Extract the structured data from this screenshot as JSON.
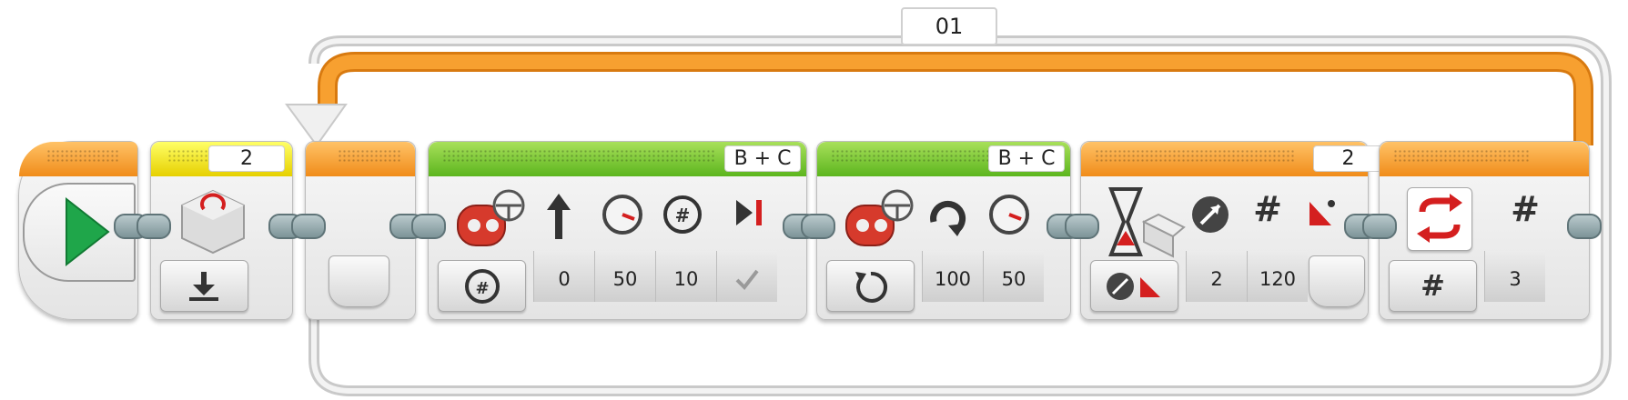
{
  "loop": {
    "name_label": "01"
  },
  "blocks": {
    "start": {},
    "brick": {
      "header_value": "2"
    },
    "move_tank_1": {
      "ports": "B + C",
      "params": [
        "0",
        "50",
        "10"
      ]
    },
    "move_tank_2": {
      "ports": "B + C",
      "params": [
        "100",
        "50"
      ]
    },
    "wait": {
      "header_value": "2",
      "params": [
        "2",
        "120"
      ]
    },
    "loop_interrupt": {
      "params": [
        "3"
      ]
    }
  },
  "colors": {
    "flow_orange": "#f7941d",
    "action_green": "#6cc02a",
    "sensor_yellow": "#ffe600",
    "start_green": "#1fa64a"
  }
}
